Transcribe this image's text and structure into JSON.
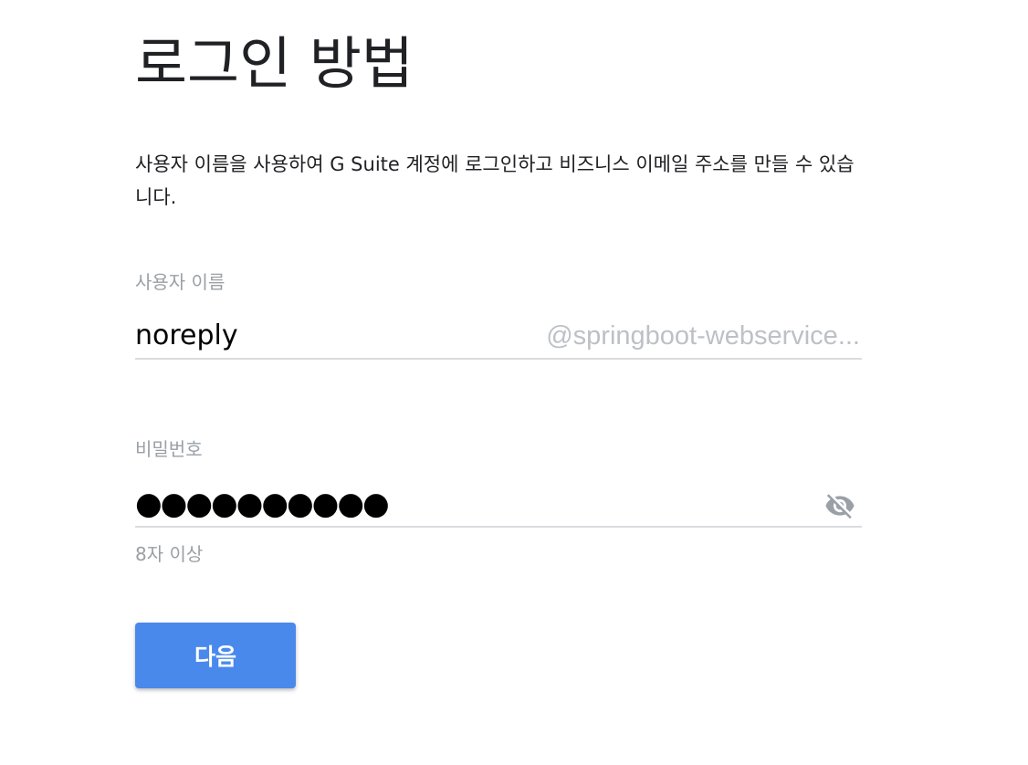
{
  "title": "로그인 방법",
  "description": "사용자 이름을 사용하여 G Suite 계정에 로그인하고 비즈니스 이메일 주소를 만들 수 있습니다.",
  "username": {
    "label": "사용자 이름",
    "value": "noreply",
    "domain_suffix": "@springboot-webservice..."
  },
  "password": {
    "label": "비밀번호",
    "masked_value": "●●●●●●●●●●",
    "hint": "8자 이상",
    "toggle_icon": "visibility-off-icon"
  },
  "next_button": {
    "label": "다음"
  },
  "colors": {
    "primary_button": "#4a89ec",
    "label_gray": "#9aa0a6",
    "underline": "#dadce0",
    "suffix_gray": "#bdc1c6"
  }
}
